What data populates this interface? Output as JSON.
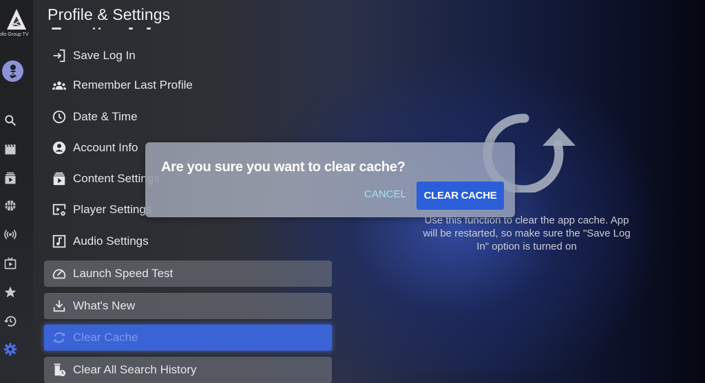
{
  "app": {
    "logo_text": "ollo Group TV",
    "page_title": "Profile & Settings"
  },
  "rail": {
    "icons": [
      {
        "name": "search-icon"
      },
      {
        "name": "movies-icon"
      },
      {
        "name": "series-icon"
      },
      {
        "name": "sports-icon"
      },
      {
        "name": "live-icon"
      },
      {
        "name": "tv-icon"
      },
      {
        "name": "favorites-icon"
      },
      {
        "name": "history-icon"
      },
      {
        "name": "settings-icon",
        "active": true
      }
    ],
    "active_color": "#4a6fe0"
  },
  "menu": {
    "items": [
      {
        "label": "Save Log In",
        "icon": "login-icon"
      },
      {
        "label": "Remember Last Profile",
        "icon": "group-icon"
      },
      {
        "label": "Date & Time",
        "icon": "clock-icon"
      },
      {
        "label": "Account Info",
        "icon": "account-icon"
      },
      {
        "label": "Content Settings",
        "icon": "content-icon"
      },
      {
        "label": "Player Settings",
        "icon": "player-settings-icon"
      },
      {
        "label": "Audio Settings",
        "icon": "audio-icon"
      },
      {
        "label": "Launch Speed Test",
        "icon": "speedometer-icon"
      },
      {
        "label": "What's New",
        "icon": "download-icon"
      },
      {
        "label": "Clear Cache",
        "icon": "refresh-icon",
        "selected": true
      },
      {
        "label": "Clear All Search History",
        "icon": "delete-history-icon"
      }
    ]
  },
  "dialog": {
    "message": "Are you sure you want to clear cache?",
    "cancel_label": "CANCEL",
    "confirm_label": "CLEAR CACHE"
  },
  "detail": {
    "icon": "refresh-icon",
    "description": "Use this function to clear the app cache. App will be restarted, so make sure the \"Save Log In\" option is turned on"
  },
  "colors": {
    "accent": "#2b5fd9",
    "selected_item": "#3a63d6",
    "cancel_text": "#9fe3f2"
  }
}
